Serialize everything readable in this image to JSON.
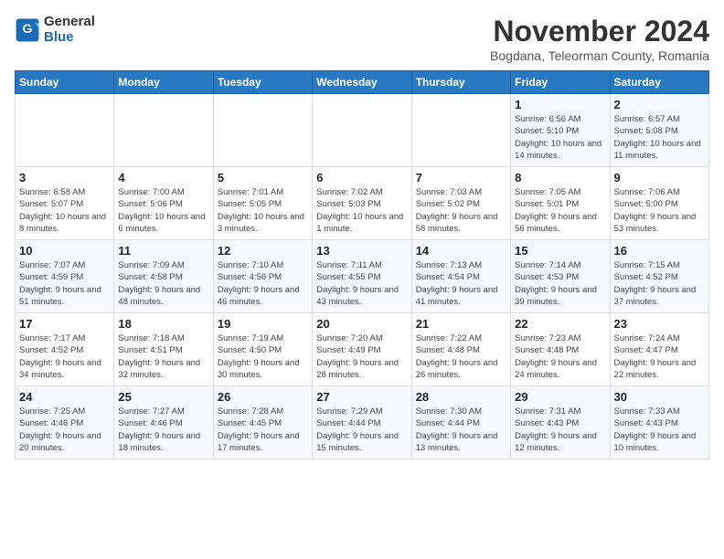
{
  "logo": {
    "line1": "General",
    "line2": "Blue"
  },
  "title": "November 2024",
  "location": "Bogdana, Teleorman County, Romania",
  "weekdays": [
    "Sunday",
    "Monday",
    "Tuesday",
    "Wednesday",
    "Thursday",
    "Friday",
    "Saturday"
  ],
  "weeks": [
    [
      {
        "day": "",
        "info": ""
      },
      {
        "day": "",
        "info": ""
      },
      {
        "day": "",
        "info": ""
      },
      {
        "day": "",
        "info": ""
      },
      {
        "day": "",
        "info": ""
      },
      {
        "day": "1",
        "info": "Sunrise: 6:56 AM\nSunset: 5:10 PM\nDaylight: 10 hours and 14 minutes."
      },
      {
        "day": "2",
        "info": "Sunrise: 6:57 AM\nSunset: 5:08 PM\nDaylight: 10 hours and 11 minutes."
      }
    ],
    [
      {
        "day": "3",
        "info": "Sunrise: 6:58 AM\nSunset: 5:07 PM\nDaylight: 10 hours and 8 minutes."
      },
      {
        "day": "4",
        "info": "Sunrise: 7:00 AM\nSunset: 5:06 PM\nDaylight: 10 hours and 6 minutes."
      },
      {
        "day": "5",
        "info": "Sunrise: 7:01 AM\nSunset: 5:05 PM\nDaylight: 10 hours and 3 minutes."
      },
      {
        "day": "6",
        "info": "Sunrise: 7:02 AM\nSunset: 5:03 PM\nDaylight: 10 hours and 1 minute."
      },
      {
        "day": "7",
        "info": "Sunrise: 7:03 AM\nSunset: 5:02 PM\nDaylight: 9 hours and 58 minutes."
      },
      {
        "day": "8",
        "info": "Sunrise: 7:05 AM\nSunset: 5:01 PM\nDaylight: 9 hours and 56 minutes."
      },
      {
        "day": "9",
        "info": "Sunrise: 7:06 AM\nSunset: 5:00 PM\nDaylight: 9 hours and 53 minutes."
      }
    ],
    [
      {
        "day": "10",
        "info": "Sunrise: 7:07 AM\nSunset: 4:59 PM\nDaylight: 9 hours and 51 minutes."
      },
      {
        "day": "11",
        "info": "Sunrise: 7:09 AM\nSunset: 4:58 PM\nDaylight: 9 hours and 48 minutes."
      },
      {
        "day": "12",
        "info": "Sunrise: 7:10 AM\nSunset: 4:56 PM\nDaylight: 9 hours and 46 minutes."
      },
      {
        "day": "13",
        "info": "Sunrise: 7:11 AM\nSunset: 4:55 PM\nDaylight: 9 hours and 43 minutes."
      },
      {
        "day": "14",
        "info": "Sunrise: 7:13 AM\nSunset: 4:54 PM\nDaylight: 9 hours and 41 minutes."
      },
      {
        "day": "15",
        "info": "Sunrise: 7:14 AM\nSunset: 4:53 PM\nDaylight: 9 hours and 39 minutes."
      },
      {
        "day": "16",
        "info": "Sunrise: 7:15 AM\nSunset: 4:52 PM\nDaylight: 9 hours and 37 minutes."
      }
    ],
    [
      {
        "day": "17",
        "info": "Sunrise: 7:17 AM\nSunset: 4:52 PM\nDaylight: 9 hours and 34 minutes."
      },
      {
        "day": "18",
        "info": "Sunrise: 7:18 AM\nSunset: 4:51 PM\nDaylight: 9 hours and 32 minutes."
      },
      {
        "day": "19",
        "info": "Sunrise: 7:19 AM\nSunset: 4:50 PM\nDaylight: 9 hours and 30 minutes."
      },
      {
        "day": "20",
        "info": "Sunrise: 7:20 AM\nSunset: 4:49 PM\nDaylight: 9 hours and 28 minutes."
      },
      {
        "day": "21",
        "info": "Sunrise: 7:22 AM\nSunset: 4:48 PM\nDaylight: 9 hours and 26 minutes."
      },
      {
        "day": "22",
        "info": "Sunrise: 7:23 AM\nSunset: 4:48 PM\nDaylight: 9 hours and 24 minutes."
      },
      {
        "day": "23",
        "info": "Sunrise: 7:24 AM\nSunset: 4:47 PM\nDaylight: 9 hours and 22 minutes."
      }
    ],
    [
      {
        "day": "24",
        "info": "Sunrise: 7:25 AM\nSunset: 4:46 PM\nDaylight: 9 hours and 20 minutes."
      },
      {
        "day": "25",
        "info": "Sunrise: 7:27 AM\nSunset: 4:46 PM\nDaylight: 9 hours and 18 minutes."
      },
      {
        "day": "26",
        "info": "Sunrise: 7:28 AM\nSunset: 4:45 PM\nDaylight: 9 hours and 17 minutes."
      },
      {
        "day": "27",
        "info": "Sunrise: 7:29 AM\nSunset: 4:44 PM\nDaylight: 9 hours and 15 minutes."
      },
      {
        "day": "28",
        "info": "Sunrise: 7:30 AM\nSunset: 4:44 PM\nDaylight: 9 hours and 13 minutes."
      },
      {
        "day": "29",
        "info": "Sunrise: 7:31 AM\nSunset: 4:43 PM\nDaylight: 9 hours and 12 minutes."
      },
      {
        "day": "30",
        "info": "Sunrise: 7:33 AM\nSunset: 4:43 PM\nDaylight: 9 hours and 10 minutes."
      }
    ]
  ]
}
